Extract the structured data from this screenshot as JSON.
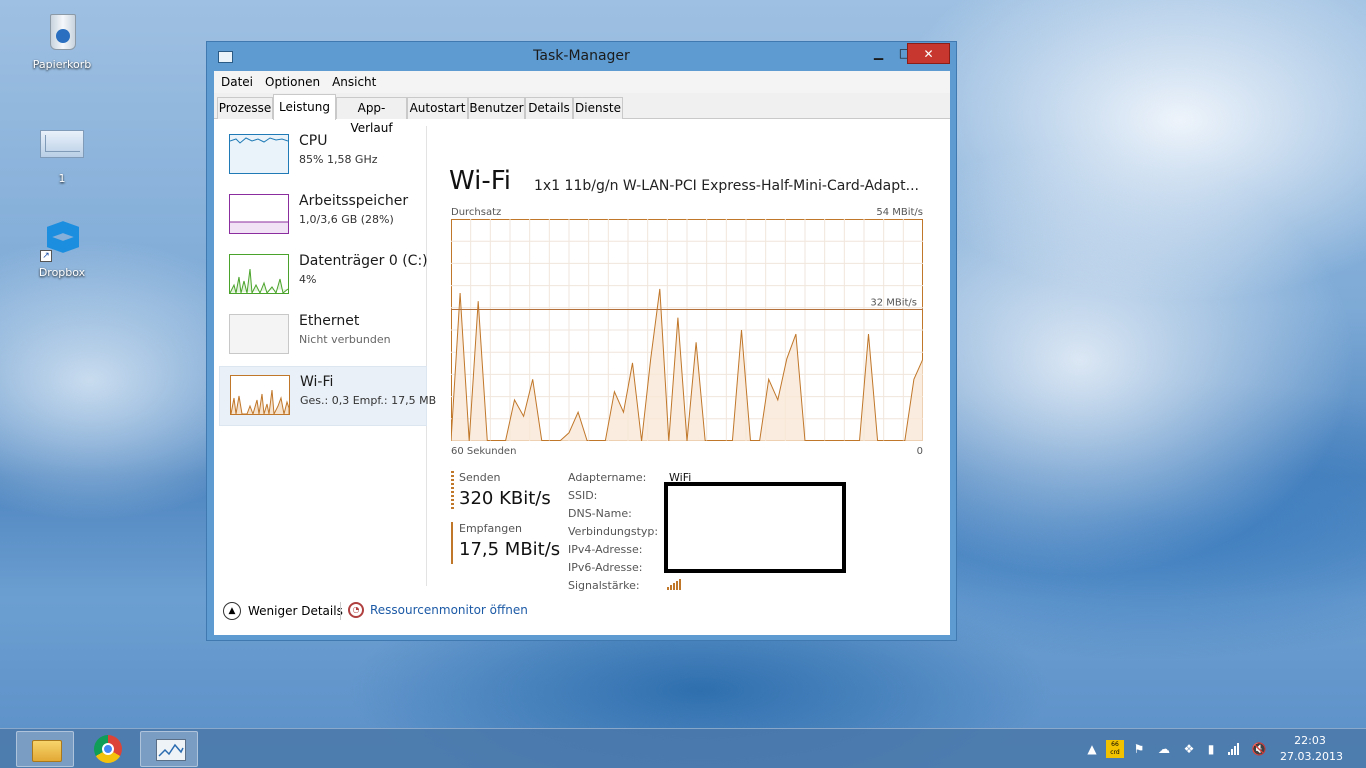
{
  "desktop": {
    "icons": [
      {
        "label": "Papierkorb",
        "icon": "recycle-bin-icon"
      },
      {
        "label": "1",
        "icon": "mail-file-icon"
      },
      {
        "label": "Dropbox",
        "icon": "dropbox-icon"
      }
    ]
  },
  "window": {
    "title": "Task-Manager",
    "minimize_glyph": "▁",
    "maximize_glyph": "□",
    "close_glyph": "✕",
    "menu": [
      "Datei",
      "Optionen",
      "Ansicht"
    ],
    "tabs": [
      "Prozesse",
      "Leistung",
      "App-Verlauf",
      "Autostart",
      "Benutzer",
      "Details",
      "Dienste"
    ],
    "active_tab": "Leistung"
  },
  "sidebar": {
    "items": [
      {
        "name": "CPU",
        "sub": "85%  1,58 GHz",
        "color": "#1f7ab5"
      },
      {
        "name": "Arbeitsspeicher",
        "sub": "1,0/3,6 GB (28%)",
        "color": "#8b2d9e"
      },
      {
        "name": "Datenträger 0 (C:)",
        "sub": "4%",
        "color": "#4aa32a"
      },
      {
        "name": "Ethernet",
        "sub": "Nicht verbunden",
        "color": "#a0a0a0"
      },
      {
        "name": "Wi-Fi",
        "sub": "Ges.: 0,3 Empf.: 17,5 MB",
        "color": "#c0772a"
      }
    ],
    "selected": "Wi-Fi"
  },
  "main": {
    "heading": "Wi-Fi",
    "adapter": "1x1 11b/g/n W-LAN-PCI Express-Half-Mini-Card-Adapt...",
    "graph_label": "Durchsatz",
    "max_label": "54 MBit/s",
    "mid_label": "32 MBit/s",
    "x_left": "60 Sekunden",
    "x_right": "0",
    "send_label": "Senden",
    "send_value": "320 KBit/s",
    "recv_label": "Empfangen",
    "recv_value": "17,5 MBit/s",
    "properties": [
      {
        "label": "Adaptername:",
        "value": "WiFi"
      },
      {
        "label": "SSID:",
        "value": ""
      },
      {
        "label": "DNS-Name:",
        "value": ""
      },
      {
        "label": "Verbindungstyp:",
        "value": ""
      },
      {
        "label": "IPv4-Adresse:",
        "value": ""
      },
      {
        "label": "IPv6-Adresse:",
        "value": ""
      },
      {
        "label": "Signalstärke:",
        "value": ""
      }
    ],
    "accent": "#c0772a"
  },
  "chart_data": {
    "type": "area",
    "title": "Durchsatz",
    "xlabel": "",
    "ylabel": "",
    "x_range_labels": [
      "60 Sekunden",
      "0"
    ],
    "ylim": [
      0,
      54
    ],
    "reference_line": 32,
    "series": [
      {
        "values": [
          0,
          36,
          0,
          34,
          0,
          0,
          0,
          10,
          6,
          15,
          0,
          0,
          0,
          2,
          7,
          0,
          0,
          0,
          12,
          7,
          19,
          0,
          20,
          37,
          0,
          30,
          0,
          24,
          0,
          0,
          0,
          0,
          27,
          0,
          0,
          15,
          10,
          20,
          26,
          0,
          0,
          0,
          0,
          0,
          0,
          0,
          26,
          0,
          0,
          0,
          0,
          15,
          20
        ]
      }
    ]
  },
  "footer": {
    "fewer_details": "Weniger Details",
    "resource_monitor": "Ressourcenmonitor öffnen"
  },
  "taskbar": {
    "apps": [
      "file-explorer-icon",
      "chrome-icon",
      "task-manager-icon"
    ],
    "time": "22:03",
    "date": "27.03.2013",
    "tray_badge": "66 crd"
  }
}
